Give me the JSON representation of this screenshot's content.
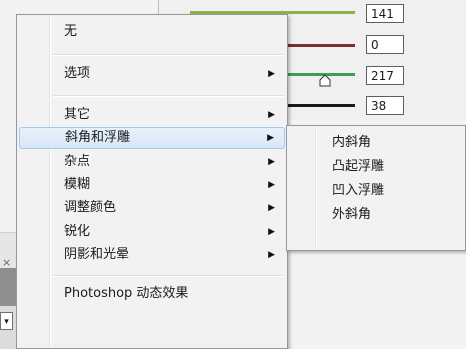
{
  "background": {
    "values": [
      "141",
      "0",
      "217",
      "38"
    ],
    "track_colors": [
      "#8fb04a",
      "#7a2e2e",
      "#3aa14a",
      "#1a1a1a"
    ]
  },
  "menu": {
    "items": [
      {
        "label": "无",
        "has_submenu": false
      },
      {
        "label": "选项",
        "has_submenu": true
      },
      {
        "label": "其它",
        "has_submenu": true
      },
      {
        "label": "斜角和浮雕",
        "has_submenu": true,
        "highlighted": true
      },
      {
        "label": "杂点",
        "has_submenu": true
      },
      {
        "label": "模糊",
        "has_submenu": true
      },
      {
        "label": "调整颜色",
        "has_submenu": true
      },
      {
        "label": "锐化",
        "has_submenu": true
      },
      {
        "label": "阴影和光晕",
        "has_submenu": true
      },
      {
        "label": "Photoshop 动态效果",
        "has_submenu": false
      }
    ]
  },
  "submenu": {
    "items": [
      {
        "label": "内斜角"
      },
      {
        "label": "凸起浮雕"
      },
      {
        "label": "凹入浮雕"
      },
      {
        "label": "外斜角"
      }
    ]
  },
  "icons": {
    "submenu_arrow": "triangle-right-icon",
    "slider_thumb": "slider-thumb-icon",
    "dropdown": "chevron-down-icon"
  }
}
